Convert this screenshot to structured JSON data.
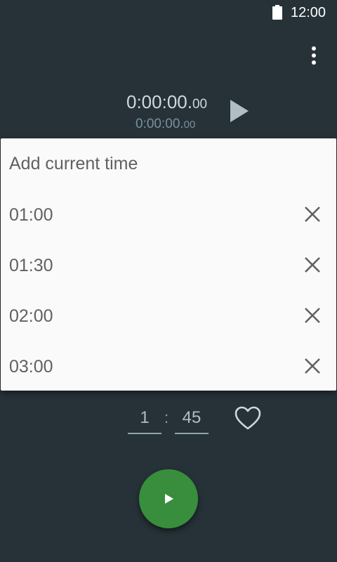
{
  "status_bar": {
    "time": "12:00"
  },
  "timer": {
    "main_time": "0:00:00.",
    "main_fraction": "00",
    "sub_time": "0:00:00.",
    "sub_fraction": "00"
  },
  "menu": {
    "title": "Add current time",
    "items": [
      {
        "label": "01:00"
      },
      {
        "label": "01:30"
      },
      {
        "label": "02:00"
      },
      {
        "label": "03:00"
      }
    ]
  },
  "input": {
    "minutes": "1",
    "separator": ":",
    "seconds": "45"
  },
  "colors": {
    "background": "#263238",
    "fab": "#388e3c",
    "menu": "#fafafa"
  },
  "icons": [
    "battery-icon",
    "overflow-menu-icon",
    "play-icon",
    "close-icon",
    "heart-icon",
    "play-icon"
  ]
}
